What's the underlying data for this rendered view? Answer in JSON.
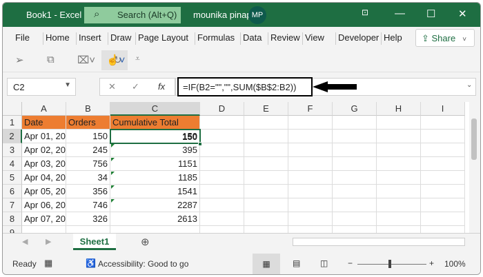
{
  "window": {
    "title": "Book1  -  Excel",
    "search_placeholder": "Search (Alt+Q)",
    "user": "mounika pinapala",
    "avatar_initials": "MP"
  },
  "ribbon": {
    "tabs": [
      "File",
      "Home",
      "Insert",
      "Draw",
      "Page Layout",
      "Formulas",
      "Data",
      "Review",
      "View",
      "Developer",
      "Help"
    ],
    "share_label": "Share"
  },
  "formula_bar": {
    "name_box": "C2",
    "fx_label": "fx",
    "formula": "=IF(B2=\"\",\"\",SUM($B$2:B2))"
  },
  "grid": {
    "columns": [
      "A",
      "B",
      "C",
      "D",
      "E",
      "F",
      "G",
      "H",
      "I"
    ],
    "rows": [
      "1",
      "2",
      "3",
      "4",
      "5",
      "6",
      "7",
      "8",
      "9"
    ],
    "headers": [
      "Date",
      "Orders",
      "Cumulative Total"
    ],
    "data": [
      [
        "Apr 01, 20",
        "150",
        "150"
      ],
      [
        "Apr 02, 20",
        "245",
        "395"
      ],
      [
        "Apr 03, 20",
        "756",
        "1151"
      ],
      [
        "Apr 04, 20",
        "34",
        "1185"
      ],
      [
        "Apr 05, 20",
        "356",
        "1541"
      ],
      [
        "Apr 06, 20",
        "746",
        "2287"
      ],
      [
        "Apr 07, 20",
        "326",
        "2613"
      ]
    ],
    "header_fill": "#ed7d31"
  },
  "sheets": {
    "active": "Sheet1"
  },
  "status": {
    "ready": "Ready",
    "accessibility": "Accessibility: Good to go",
    "zoom": "100%"
  },
  "colors": {
    "brand": "#1e6e42"
  }
}
